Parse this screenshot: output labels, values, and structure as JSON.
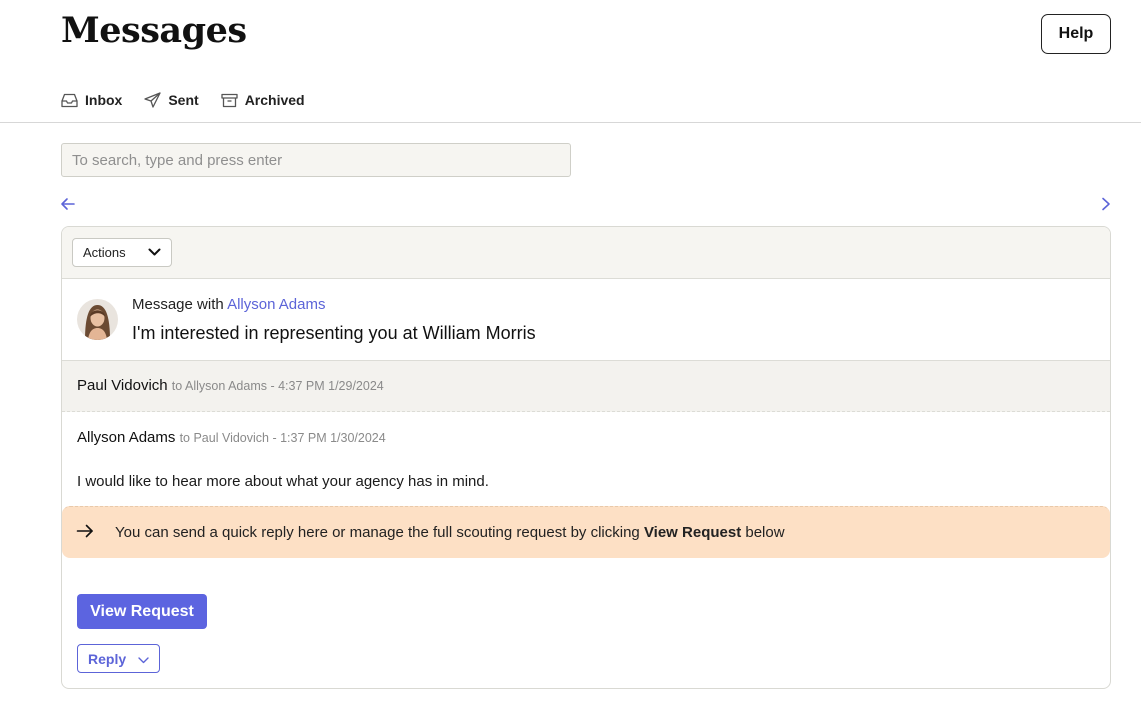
{
  "header": {
    "title": "Messages",
    "help_label": "Help"
  },
  "tabs": [
    {
      "label": "Inbox",
      "icon": "inbox-icon"
    },
    {
      "label": "Sent",
      "icon": "send-icon"
    },
    {
      "label": "Archived",
      "icon": "archive-icon"
    }
  ],
  "search": {
    "placeholder": "To search, type and press enter",
    "value": ""
  },
  "card": {
    "actions_label": "Actions",
    "thread": {
      "prefix": "Message with",
      "contact": "Allyson Adams",
      "subject": "I'm interested in representing you at William Morris"
    },
    "messages": [
      {
        "sender": "Paul Vidovich",
        "meta": "to Allyson Adams - 4:37 PM 1/29/2024",
        "body": ""
      },
      {
        "sender": "Allyson Adams",
        "meta": "to Paul Vidovich - 1:37 PM 1/30/2024",
        "body": "I would like to hear more about what your agency has in mind."
      }
    ],
    "hint": {
      "before": "You can send a quick reply here or manage the full scouting request by clicking",
      "bold": "View Request",
      "after": "below"
    },
    "view_request_label": "View Request",
    "reply_label": "Reply"
  },
  "colors": {
    "accent": "#5c64e0",
    "hint_bg": "#fde0c5",
    "toolbar_bg": "#f6f5f1"
  }
}
